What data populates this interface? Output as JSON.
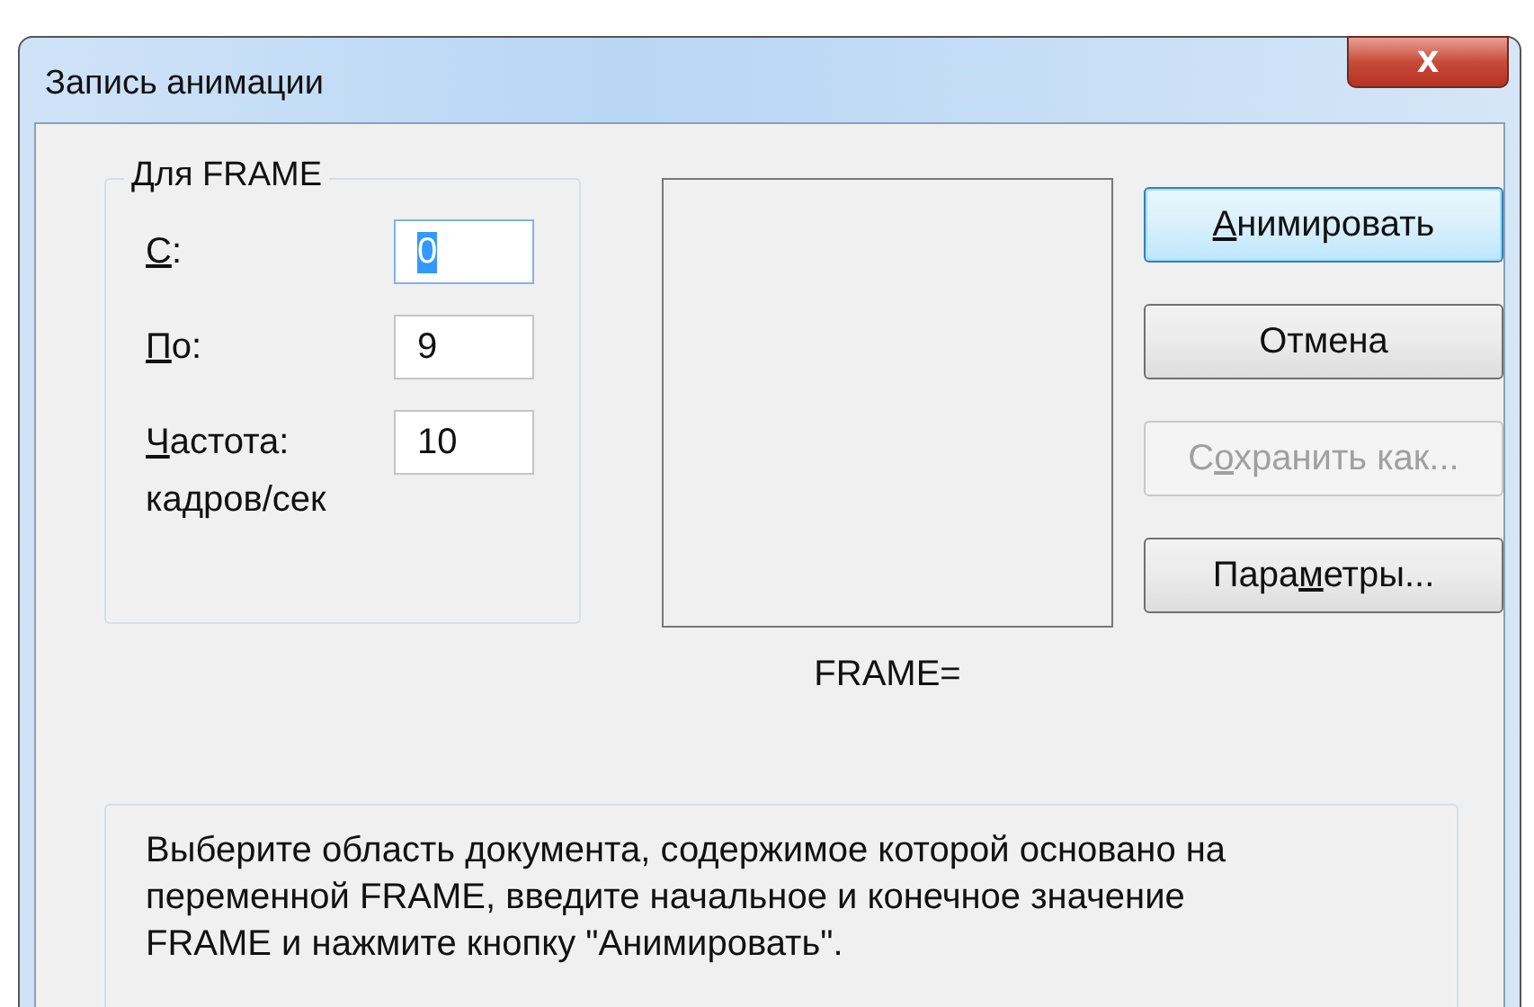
{
  "window": {
    "title": "Запись анимации",
    "close_glyph": "X"
  },
  "group": {
    "title": "Для FRAME",
    "fields": [
      {
        "label": {
          "key": "С",
          "post": ":"
        },
        "value": "0",
        "focused": true
      },
      {
        "label": {
          "key": "П",
          "post": "о:"
        },
        "value": "9",
        "focused": false
      },
      {
        "label": {
          "key": "Ч",
          "post": "астота:"
        },
        "value": "10",
        "focused": false
      }
    ],
    "unit": "кадров/сек"
  },
  "preview": {
    "caption": "FRAME="
  },
  "buttons": [
    {
      "label": {
        "key": "А",
        "post": "нимировать"
      },
      "default": true,
      "disabled": false
    },
    {
      "label": {
        "pre": "Отмена"
      },
      "default": false,
      "disabled": false
    },
    {
      "label": {
        "pre": "С",
        "key": "о",
        "post": "хранить как..."
      },
      "default": false,
      "disabled": true
    },
    {
      "label": {
        "pre": "Пара",
        "key": "м",
        "post": "етры..."
      },
      "default": false,
      "disabled": false
    }
  ],
  "hint": "Выберите область документа, содержимое которой основано на переменной FRAME, введите начальное и конечное значение FRAME и нажмите кнопку \"Анимировать\"."
}
